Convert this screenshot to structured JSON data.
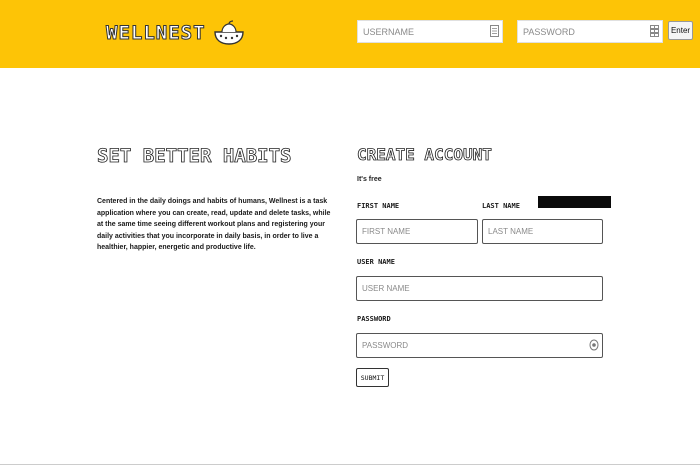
{
  "header": {
    "logo_text": "WELLNEST",
    "username_placeholder": "USERNAME",
    "password_placeholder": "PASSWORD",
    "enter_label": "Enter"
  },
  "hero": {
    "title": "SET BETTER HABITS",
    "body": "Centered in the daily doings and habits of humans, Wellnest is a task application where you can create, read, update and delete tasks, while at the same time seeing different workout plans and registering your daily activities that you incorporate in daily basis, in order to live a healthier, happier, energetic and productive life."
  },
  "form": {
    "title": "CREATE ACCOUNT",
    "subtitle": "It's free",
    "first_name_label": "FIRST NAME",
    "first_name_placeholder": "FIRST NAME",
    "last_name_label": "LAST NAME",
    "last_name_placeholder": "LAST NAME",
    "user_name_label": "USER NAME",
    "user_name_placeholder": "USER NAME",
    "password_label": "PASSWORD",
    "password_placeholder": "PASSWORD",
    "submit_label": "SUBMIT"
  },
  "icons": {
    "logo": "bowl-icon",
    "username_field": "id-card-icon",
    "password_field": "keypad-icon",
    "password_visibility": "eye-icon"
  },
  "colors": {
    "header_background": "#fdc406"
  }
}
